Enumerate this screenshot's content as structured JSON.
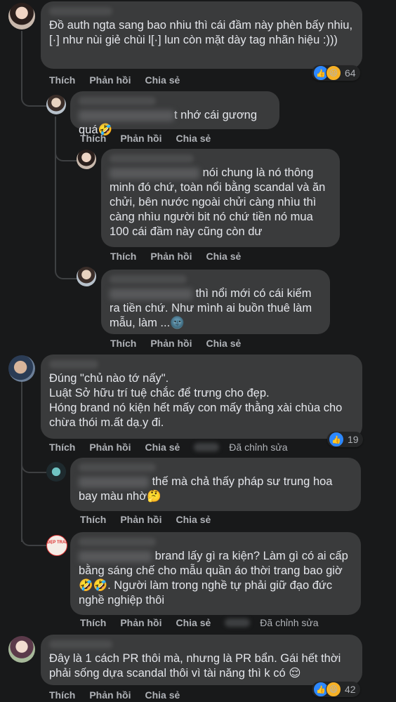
{
  "actions": {
    "like": "Thích",
    "reply": "Phản hồi",
    "share": "Chia sẻ",
    "edited": "Đã chỉnh sửa"
  },
  "comments": [
    {
      "text": "Đồ auth ngta sang bao nhiu thì cái đầm này phèn bấy nhiu, [·] như nùi giẻ chùi l[·] lun còn mặt dày tag nhãn hiệu :)))",
      "reactions": "64"
    },
    {
      "text": "t nhớ cái gương quá🤣"
    },
    {
      "text": "nói chung là nó thông minh đó chứ, toàn nổi bằng scandal và ăn chửi, bên nước ngoài chửi càng nhìu thì càng nhìu người bit nó chứ tiền nó mua 100 cái đầm này cũng còn dư"
    },
    {
      "text": "thì nổi mới có cái kiếm ra tiền chứ. Như mình ai buồn thuê làm mẫu, làm ...🌚"
    },
    {
      "text": "Đúng \"chủ nào tớ nấy\".\nLuật Sở hữu trí tuệ chắc để trưng cho đẹp.\nHóng brand nó kiện hết mấy con mấy thằng xài chùa cho chừa thói m.ất dạ.y đi.",
      "reactions": "19"
    },
    {
      "text": "thế mà chả thấy pháp sư trung hoa bay màu nhờ🤔"
    },
    {
      "text": "brand lấy gì ra kiện? Làm gì có ai cấp bằng sáng chế cho mẫu quần áo thời trang bao giờ🤣🤣. Người làm trong nghề tự phải giữ đạo đức nghề nghiệp thôi"
    },
    {
      "text": "Đây là 1 cách PR thôi mà, nhưng là PR bẩn. Gái hết thời phải sống dựa scandal thôi vì tài năng thì k có 😌",
      "reactions": "42"
    }
  ],
  "avatar_badge": "ĐẸP TRAI",
  "colors": {
    "background": "#18191a",
    "bubble": "#3a3b3c",
    "text": "#e4e6eb",
    "secondary": "#b0b3b8",
    "like": "#2d88ff",
    "haha": "#f7b125"
  }
}
